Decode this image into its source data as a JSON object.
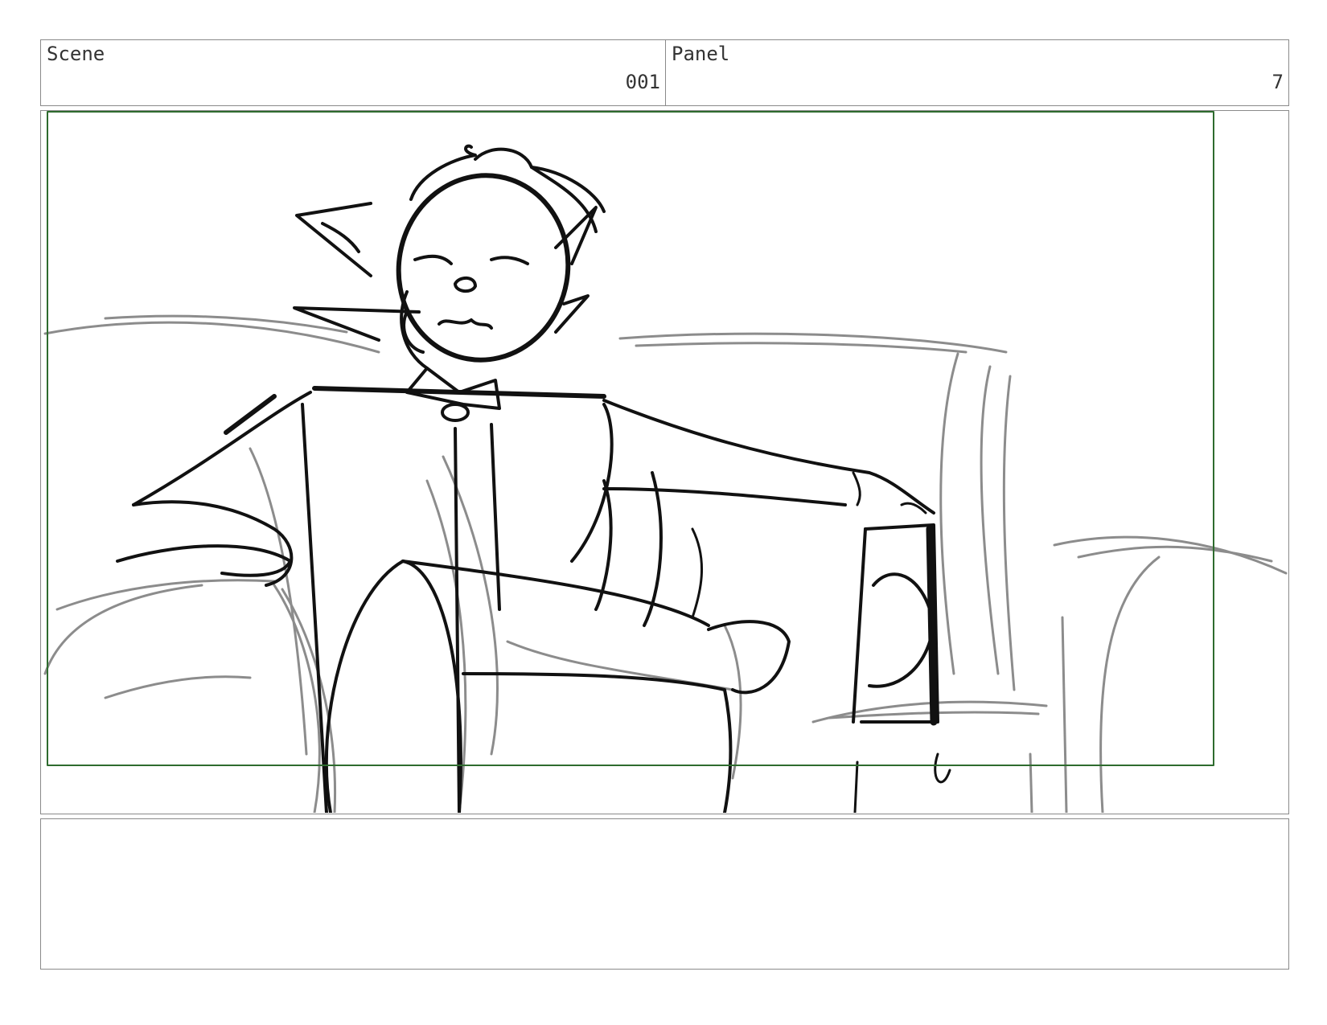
{
  "header": {
    "scene_label": "Scene",
    "scene_value": "001",
    "panel_label": "Panel",
    "panel_value": "7"
  },
  "notes": {
    "text": ""
  },
  "colors": {
    "safe_frame": "#2e6b2e",
    "border": "#8a8a8a",
    "ink": "#111111",
    "pencil": "#8c8c8c"
  }
}
